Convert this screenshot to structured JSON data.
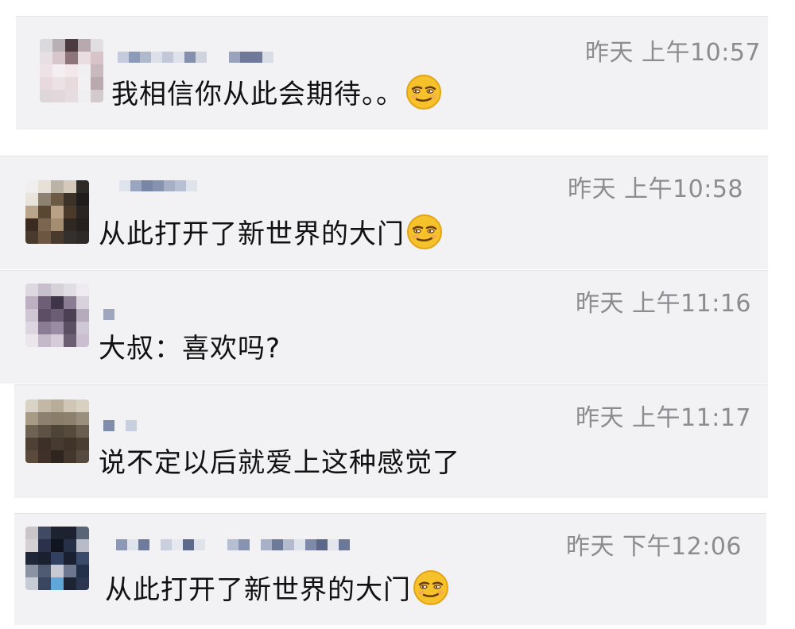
{
  "comments": [
    {
      "time": "昨天 上午10:57",
      "text": "我相信你从此会期待。。",
      "emoji": "smirk-face-icon",
      "avatar_colors": [
        "#d9d9de",
        "#b9b0b4",
        "#4c3b40",
        "#b8a9ad",
        "#e1dde0",
        "#e6dfe3",
        "#d7c6cc",
        "#8d757b",
        "#eadde1",
        "#d6c4c8",
        "#efe2e6",
        "#f4eef2",
        "#f2e7ea",
        "#f0f0f2",
        "#c8b9be",
        "#e8d9dd",
        "#ece1e4",
        "#e9dadd",
        "#f2f0f2",
        "#b9a9ad",
        "#ddd7da",
        "#e2d7da",
        "#e7dde0",
        "#efeff2",
        "#d2cacd"
      ]
    },
    {
      "time": "昨天 上午10:58",
      "text": "从此打开了新世界的大门",
      "emoji": "smirk-face-icon",
      "avatar_colors": [
        "#f0eeee",
        "#e6e0d8",
        "#bcb3a7",
        "#d4c9ba",
        "#2d2a28",
        "#e8e4dc",
        "#8e8172",
        "#6d5a44",
        "#3d3228",
        "#1f1c1b",
        "#b8a58c",
        "#5a4733",
        "#b9a185",
        "#4b3a2a",
        "#2a2522",
        "#3a2a1f",
        "#7b6450",
        "#a48d70",
        "#2f2721",
        "#25201d",
        "#4a3a2e",
        "#6e5742",
        "#4a3a2e",
        "#34302d",
        "#2d2a28"
      ]
    },
    {
      "time": "昨天 上午11:16",
      "text": "大叔：喜欢吗?",
      "emoji": "",
      "avatar_colors": [
        "#ded9e0",
        "#c7bfcc",
        "#d6d0d9",
        "#e1dde4",
        "#eeeaf0",
        "#bdb0c3",
        "#6e5f76",
        "#3f3548",
        "#8a7c93",
        "#d8d2dc",
        "#cfc6d4",
        "#5d4e66",
        "#6b5d74",
        "#4c4054",
        "#b6aabd",
        "#ddd6e0",
        "#8a7c93",
        "#9a8da3",
        "#5b4f64",
        "#d0c7d5",
        "#eae6ec",
        "#c4b9c9",
        "#d4ccd8",
        "#6b5e73",
        "#cabfd0"
      ]
    },
    {
      "time": "昨天 上午11:17",
      "text": "说不定以后就爱上这种感觉了",
      "emoji": "",
      "avatar_colors": [
        "#d9d2c6",
        "#c2b8a5",
        "#b8ad99",
        "#cfc6b6",
        "#d8d0c1",
        "#a79b86",
        "#8d8070",
        "#8a7d6a",
        "#8d806d",
        "#9a8f7c",
        "#6e6253",
        "#5e5244",
        "#4e4438",
        "#564a3d",
        "#6a5e50",
        "#4e4034",
        "#3c3028",
        "#473b31",
        "#3f332a",
        "#4a3e33",
        "#5a4a3c",
        "#3f3129",
        "#2f251f",
        "#43362c",
        "#574a3e"
      ]
    },
    {
      "time": "昨天 下午12:06",
      "text": "从此打开了新世界的大门",
      "emoji": "smirk-face-icon",
      "avatar_colors": [
        "#c9c5c8",
        "#404a62",
        "#1e2331",
        "#1d2130",
        "#5a6477",
        "#d4d0d3",
        "#29324a",
        "#101520",
        "#263047",
        "#b7bcc8",
        "#1f2637",
        "#1b2030",
        "#324061",
        "#1a2032",
        "#3a4a6b",
        "#8a92a4",
        "#4e5a72",
        "#c7cad3",
        "#6d7890",
        "#223049",
        "#c6cbd4",
        "#3a4560",
        "#61a6d8",
        "#1d2535",
        "#2c3650"
      ]
    }
  ]
}
